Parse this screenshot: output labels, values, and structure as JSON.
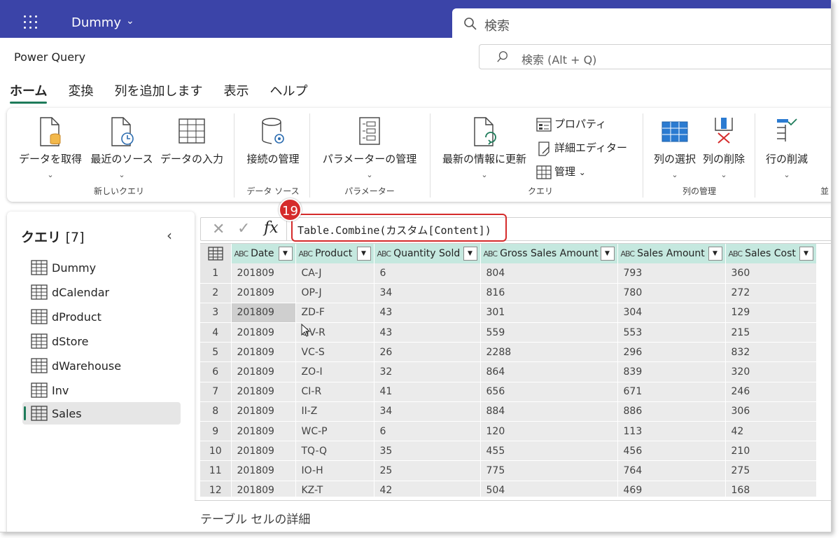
{
  "topbar": {
    "workspace": "Dummy",
    "search_placeholder": "検索"
  },
  "app": {
    "title": "Power Query",
    "search_placeholder": "検索 (Alt + Q)"
  },
  "tabs": [
    {
      "label": "ホーム",
      "active": true
    },
    {
      "label": "変換"
    },
    {
      "label": "列を追加します"
    },
    {
      "label": "表示"
    },
    {
      "label": "ヘルプ"
    }
  ],
  "ribbon": {
    "get_data": "データを取得",
    "recent_sources": "最近のソース",
    "enter_data": "データの入力",
    "group_new_query": "新しいクエリ",
    "manage_connections": "接続の管理",
    "group_data_source": "データ ソース",
    "manage_parameters": "パラメーターの管理",
    "group_parameters": "パラメーター",
    "refresh": "最新の情報に更新",
    "properties": "プロパティ",
    "advanced_editor": "詳細エディター",
    "manage": "管理",
    "group_query": "クエリ",
    "choose_columns": "列の選択",
    "remove_columns": "列の削除",
    "group_manage_columns": "列の管理",
    "reduce_rows": "行の削減",
    "chevron": "⌄",
    "chevron_inline": "⌄",
    "clipped_group": "並"
  },
  "queries": {
    "title": "クエリ",
    "count": "[7]",
    "items": [
      "Dummy",
      "dCalendar",
      "dProduct",
      "dStore",
      "dWarehouse",
      "Inv",
      "Sales"
    ],
    "selected": "Sales"
  },
  "formula": {
    "text": "Table.Combine(カスタム[Content])",
    "callout_number": "19"
  },
  "grid": {
    "type_icon": "ABC",
    "columns": [
      "Date",
      "Product",
      "Quantity Sold",
      "Gross Sales Amount",
      "Sales Amount",
      "Sales Cost"
    ],
    "rows": [
      [
        "1",
        "201809",
        "CA-J",
        "6",
        "804",
        "793",
        "360"
      ],
      [
        "2",
        "201809",
        "OP-J",
        "34",
        "816",
        "780",
        "272"
      ],
      [
        "3",
        "201809",
        "ZD-F",
        "43",
        "301",
        "304",
        "129"
      ],
      [
        "4",
        "201809",
        "GV-R",
        "43",
        "559",
        "553",
        "215"
      ],
      [
        "5",
        "201809",
        "VC-S",
        "26",
        "2288",
        "296",
        "832"
      ],
      [
        "6",
        "201809",
        "ZO-I",
        "32",
        "864",
        "839",
        "320"
      ],
      [
        "7",
        "201809",
        "CI-R",
        "41",
        "656",
        "671",
        "246"
      ],
      [
        "8",
        "201809",
        "II-Z",
        "34",
        "884",
        "886",
        "306"
      ],
      [
        "9",
        "201809",
        "WC-P",
        "6",
        "120",
        "113",
        "42"
      ],
      [
        "10",
        "201809",
        "TQ-Q",
        "35",
        "455",
        "456",
        "210"
      ],
      [
        "11",
        "201809",
        "IO-H",
        "25",
        "775",
        "764",
        "275"
      ],
      [
        "12",
        "201809",
        "KZ-T",
        "42",
        "504",
        "469",
        "168"
      ]
    ]
  },
  "details": {
    "label": "テーブル セルの詳細"
  },
  "colors": {
    "topbar": "#3b44a8",
    "accent": "#1e7b5a",
    "header": "#c5e8df",
    "callout": "#d52b2b"
  }
}
